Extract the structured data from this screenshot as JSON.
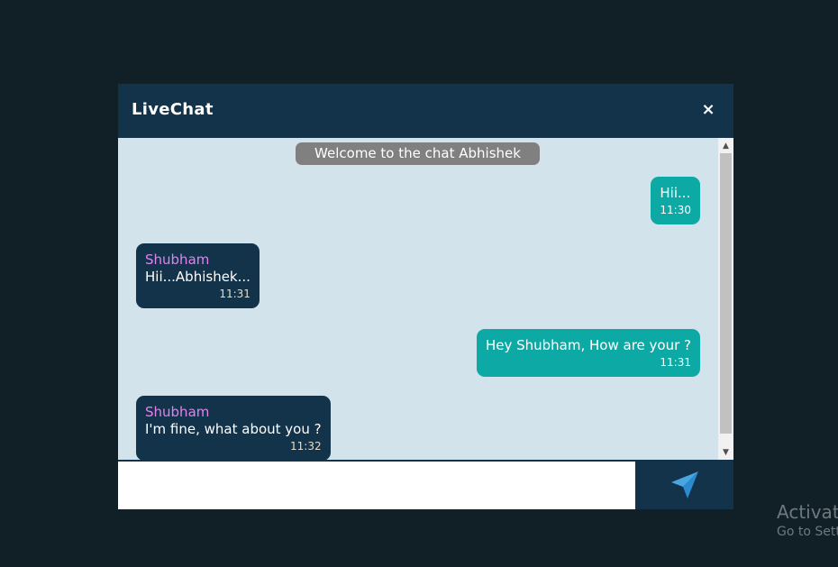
{
  "header": {
    "title": "LiveChat",
    "close_icon": "×"
  },
  "welcome": "Welcome to the chat Abhishek",
  "messages": [
    {
      "direction": "out",
      "text": "Hii...",
      "time": "11:30"
    },
    {
      "direction": "in",
      "sender": "Shubham",
      "text": "Hii...Abhishek...",
      "time": "11:31"
    },
    {
      "direction": "out",
      "text": "Hey Shubham, How are your ?",
      "time": "11:31"
    },
    {
      "direction": "in",
      "sender": "Shubham",
      "text": "I'm fine, what about you ?",
      "time": "11:32"
    }
  ],
  "input": {
    "value": "",
    "placeholder": ""
  },
  "icons": {
    "send": "send-icon",
    "close": "close-icon"
  },
  "colors": {
    "header": "#12334a",
    "chat_bg": "#d3e3eb",
    "outgoing": "#0ca9a5",
    "incoming": "#12334a",
    "sender": "#e083f0",
    "page_bg": "#111f27"
  },
  "watermark": {
    "line1": "Activate",
    "line2": "Go to Sett"
  }
}
